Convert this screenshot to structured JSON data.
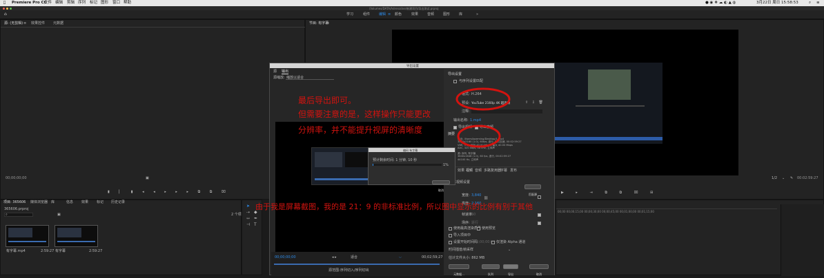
{
  "menubar": {
    "app_name": "Premiere Pro CC",
    "items": [
      "文件",
      "编辑",
      "剪辑",
      "序列",
      "标记",
      "图形",
      "窗口",
      "帮助"
    ],
    "clock": "3月22日 周日 15:58:53"
  },
  "title_path": "/Volumes/DATA/Adrenaline/新建项目/导出测试.prproj",
  "workspace_tabs": [
    "学习",
    "组件",
    "编辑",
    "颜色",
    "效果",
    "音频",
    "图形",
    "库"
  ],
  "workspace_active": "编辑",
  "source_panel": {
    "tabs": [
      "源: (无剪辑)",
      "效果控件",
      "元数据"
    ],
    "timecode": "00;00;00;00"
  },
  "program_panel": {
    "tab": "节目: 有字幕",
    "timecode": "00:02:59:27",
    "fit": "1/2"
  },
  "project_panel": {
    "tabs": [
      "项目: 365606",
      "媒体浏览器",
      "库",
      "信息",
      "效果",
      "标记",
      "历史记录"
    ],
    "project_file": "365606.prproj",
    "item_count": "2 个项",
    "items": [
      {
        "name": "有字幕.mp4",
        "duration": "2:59:27"
      },
      {
        "name": "有字幕",
        "duration": "2:59:27"
      }
    ]
  },
  "export_dialog": {
    "title": "导出设置",
    "tabs": [
      "源",
      "输出"
    ],
    "source_scaling_label": "源缩放:",
    "source_scaling_value": "缩放以适合",
    "settings_heading": "导出设置",
    "match_seq": "与序列设置匹配",
    "format_label": "格式:",
    "format_value": "H.264",
    "preset_label": "预设:",
    "preset_value": "YouTube 2160p 4K 超高清",
    "comment_label": "注释:",
    "output_name_label": "输出名称:",
    "output_name_value": "1.mp4",
    "export_video": "导出视频",
    "export_audio": "导出音频",
    "summary_heading": "摘要",
    "summary_output": "输出: /Users/lazeming/Desktop/1.mp4\n3840x2160 (1.0), 60fps, 逐行, 硬件加速, 00:02:59:27\nVBR, 1 次, 目标 40.00 Mbps, 最大 40.00 Mbps\nAAC, 320 kbps, 48 kHz, 立体声",
    "summary_source": "源: 序列, 有字幕\n3840x1648 (1.0), 60 fps, 逐行, 00:02:59:27\n44100 Hz, 立体声",
    "panel_tabs": [
      "效果",
      "视频",
      "音频",
      "多路复用器",
      "字幕",
      "发布"
    ],
    "basic_video": "基本视频设置",
    "match_source_btn": "匹配源",
    "width_label": "宽度:",
    "width_value": "3,840",
    "height_label": "高度:",
    "height_value": "2,160",
    "framerate_label": "帧速率:",
    "framerate_value": "60",
    "field_label": "场序:",
    "field_value": "逐行",
    "max_render": "使用最高渲染质量",
    "use_preview": "使用预览",
    "import_project": "导入项目中",
    "set_start_tc": "设置开始时间码",
    "start_tc": "00;00;00;00",
    "render_alpha": "仅渲染 Alpha 通道",
    "time_interp_label": "时间插值:",
    "time_interp_value": "帧采样",
    "file_size": "估计文件大小: 862 MB",
    "metadata_btn": "元数据...",
    "queue_btn": "队列",
    "export_btn": "导出",
    "cancel_btn": "取消",
    "src_timecode": "00;00;00;00",
    "src_end": "00;02;59;27",
    "fit_label": "适合",
    "range_label": "源范围:",
    "range_value": "序列切入/序列切出"
  },
  "encode_dialog": {
    "title": "编码 有字幕",
    "eta": "预计剩余时间: 1 分钟, 10 秒",
    "percent": "1%",
    "progress": 0.01,
    "cancel": "取消"
  },
  "annotations": {
    "line1": "最后导出即可。",
    "line2": "但需要注意的是，这样操作只能更改",
    "line3": "分辨率，并不能提升视屏的清晰度",
    "line4": "由于我是屏幕截图，我的是 21：9 的非标准比例，所以图中显示的比例有别于其他"
  },
  "colors": {
    "annotation_red": "#d3130f",
    "accent_blue": "#2d8ceb",
    "panel_bg": "#232323"
  }
}
